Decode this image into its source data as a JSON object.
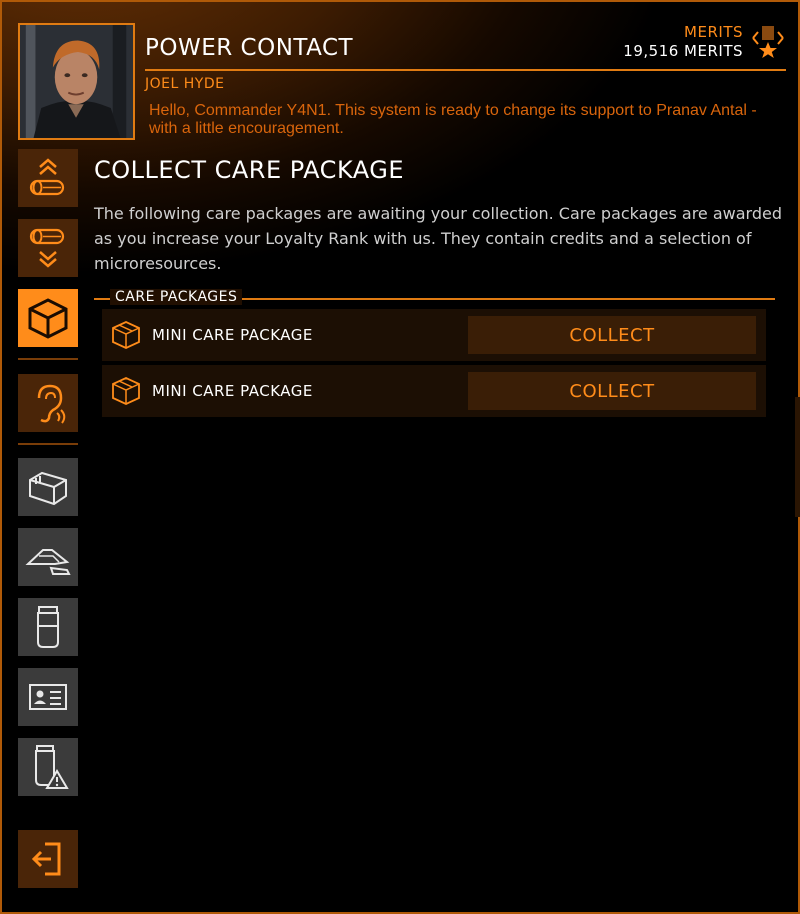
{
  "header": {
    "title": "POWER CONTACT",
    "contact_name": "JOEL HYDE",
    "message": "Hello, Commander Y4N1. This system is ready to change its support to Pranav Antal - with a little encouragement.",
    "merits_label": "MERITS",
    "merits_value": "19,516 MERITS"
  },
  "sidebar": {
    "items": [
      {
        "icon": "rank-up-icon",
        "state": "normal"
      },
      {
        "icon": "rank-down-icon",
        "state": "normal"
      },
      {
        "icon": "care-package-icon",
        "state": "active"
      },
      {
        "icon": "contact-ear-icon",
        "state": "normal"
      },
      {
        "icon": "cargo-box-icon",
        "state": "grey"
      },
      {
        "icon": "ship-icon",
        "state": "grey"
      },
      {
        "icon": "canister-icon",
        "state": "grey"
      },
      {
        "icon": "id-card-icon",
        "state": "grey"
      },
      {
        "icon": "hazard-canister-icon",
        "state": "grey"
      },
      {
        "icon": "exit-icon",
        "state": "normal"
      }
    ]
  },
  "main": {
    "section_title": "COLLECT CARE PACKAGE",
    "description": "The following care packages are awaiting your collection.  Care packages are awarded as you increase your Loyalty Rank with us. They contain credits and a selection of microresources.",
    "group_label": "CARE PACKAGES",
    "packages": [
      {
        "name": "MINI CARE PACKAGE",
        "action": "COLLECT"
      },
      {
        "name": "MINI CARE PACKAGE",
        "action": "COLLECT"
      }
    ]
  },
  "colors": {
    "accent": "#ff8c1a",
    "accent_dark": "#e07b12",
    "panel_bg": "#1c0f04",
    "button_bg": "#3a1e06",
    "sidebar_grey": "#3b3b3b"
  }
}
